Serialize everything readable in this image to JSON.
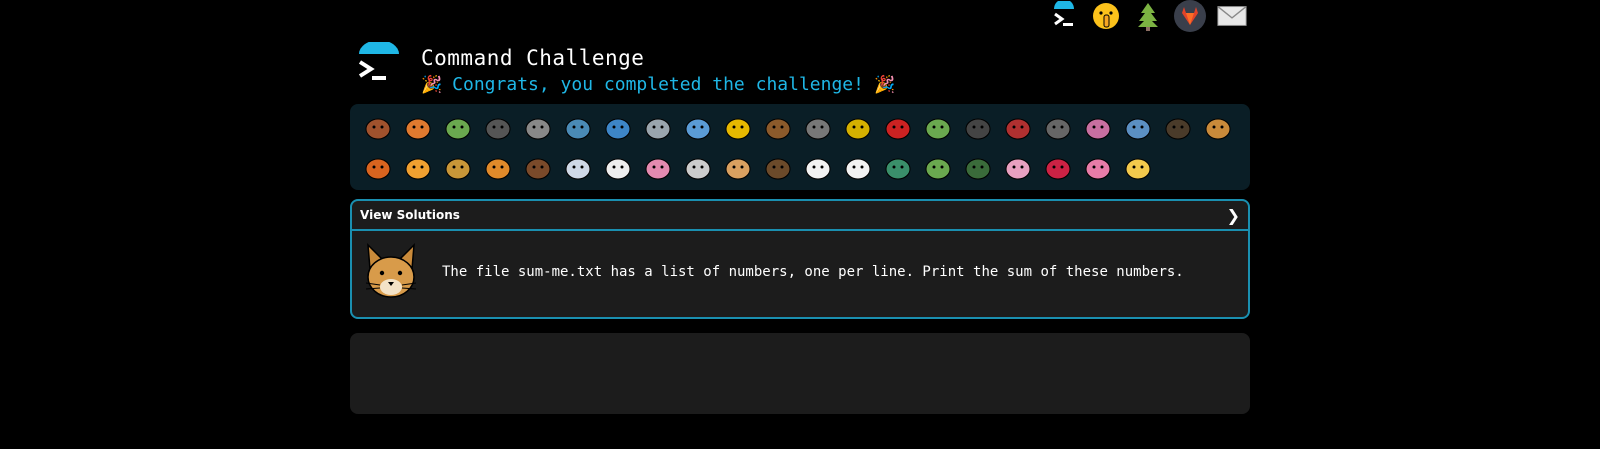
{
  "header": {
    "title": "Command Challenge",
    "congrats": "Congrats, you completed the challenge!",
    "party_icon": "🎉"
  },
  "topbar": {
    "icons": [
      "terminal-icon",
      "shush-face-icon",
      "tree-icon",
      "gitlab-icon",
      "mail-icon"
    ]
  },
  "animals": {
    "icons": [
      "snail",
      "butterfly",
      "caterpillar",
      "ant",
      "spider-web",
      "whale",
      "dolphin-blue",
      "dolphin-gray",
      "fish",
      "tropical-fish",
      "hedgehog",
      "wolf",
      "bee",
      "ladybug",
      "cricket",
      "spider",
      "scorpion",
      "fly",
      "worm",
      "microbe",
      "gorilla",
      "dog",
      "fox",
      "cat",
      "lion",
      "tiger",
      "horse",
      "unicorn",
      "cow",
      "pig",
      "mouse",
      "hamster",
      "bear",
      "panda",
      "hatching-chick",
      "peacock",
      "frog",
      "dragon",
      "cherry-blossom",
      "rose",
      "hibiscus",
      "sunflower"
    ]
  },
  "solutions": {
    "header_label": "View Solutions",
    "chevron": "❯",
    "challenge": "The file sum-me.txt has a list of numbers, one per line. Print the sum of these numbers."
  },
  "colors": {
    "accent": "#1fb7e6",
    "card_border": "#1a8fb0",
    "card_bg": "#1c1c1c",
    "animals_bg": "#0a1e26"
  }
}
